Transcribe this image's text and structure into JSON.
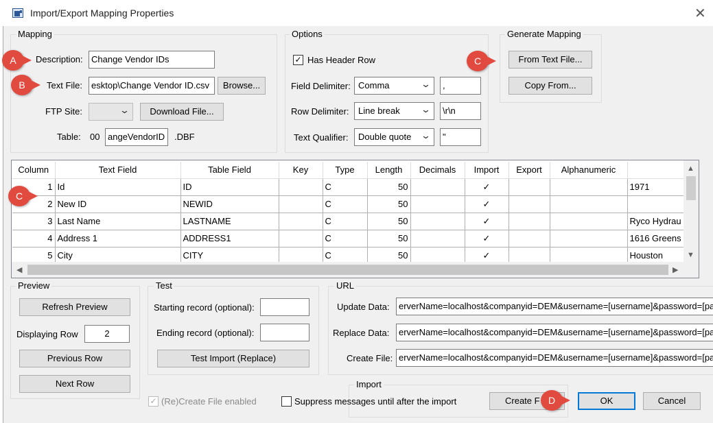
{
  "window": {
    "title": "Import/Export Mapping Properties",
    "close_glyph": "✕"
  },
  "mapping": {
    "group_label": "Mapping",
    "description_label": "Description:",
    "description_value": "Change Vendor IDs",
    "textfile_label": "Text File:",
    "textfile_value": "esktop\\Change Vendor ID.csv",
    "browse_label": "Browse...",
    "ftp_label": "FTP Site:",
    "download_label": "Download File...",
    "table_label": "Table:",
    "table_prefix": "00",
    "table_value": "angeVendorID",
    "table_ext": ".DBF"
  },
  "options": {
    "group_label": "Options",
    "has_header_label": "Has Header Row",
    "has_header_checked": true,
    "field_delim_label": "Field Delimiter:",
    "field_delim_value": "Comma",
    "field_delim_char": ",",
    "row_delim_label": "Row Delimiter:",
    "row_delim_value": "Line break",
    "row_delim_char": "\\r\\n",
    "text_qual_label": "Text Qualifier:",
    "text_qual_value": "Double quote",
    "text_qual_char": "\""
  },
  "generate": {
    "group_label": "Generate Mapping",
    "from_text_label": "From Text File...",
    "copy_from_label": "Copy From..."
  },
  "grid": {
    "columns": [
      "Column",
      "Text Field",
      "Table Field",
      "Key",
      "Type",
      "Length",
      "Decimals",
      "Import",
      "Export",
      "Alphanumeric",
      ""
    ],
    "rows": [
      {
        "col": "1",
        "text_field": "Id",
        "table_field": "ID",
        "key": "",
        "type": "C",
        "length": "50",
        "decimals": "",
        "import": "✓",
        "export": "",
        "alpha": "",
        "extra": "1971"
      },
      {
        "col": "2",
        "text_field": "New ID",
        "table_field": "NEWID",
        "key": "",
        "type": "C",
        "length": "50",
        "decimals": "",
        "import": "✓",
        "export": "",
        "alpha": "",
        "extra": ""
      },
      {
        "col": "3",
        "text_field": "Last Name",
        "table_field": "LASTNAME",
        "key": "",
        "type": "C",
        "length": "50",
        "decimals": "",
        "import": "✓",
        "export": "",
        "alpha": "",
        "extra": "Ryco Hydrau"
      },
      {
        "col": "4",
        "text_field": "Address 1",
        "table_field": "ADDRESS1",
        "key": "",
        "type": "C",
        "length": "50",
        "decimals": "",
        "import": "✓",
        "export": "",
        "alpha": "",
        "extra": "1616 Greens"
      },
      {
        "col": "5",
        "text_field": "City",
        "table_field": "CITY",
        "key": "",
        "type": "C",
        "length": "50",
        "decimals": "",
        "import": "✓",
        "export": "",
        "alpha": "",
        "extra": "Houston"
      }
    ]
  },
  "preview": {
    "group_label": "Preview",
    "refresh_label": "Refresh Preview",
    "displaying_label": "Displaying Row",
    "displaying_value": "2",
    "previous_label": "Previous Row",
    "next_label": "Next Row"
  },
  "test": {
    "group_label": "Test",
    "starting_label": "Starting record (optional):",
    "starting_value": "",
    "ending_label": "Ending record (optional):",
    "ending_value": "",
    "test_import_label": "Test Import (Replace)"
  },
  "url": {
    "group_label": "URL",
    "update_label": "Update Data:",
    "update_value": "erverName=localhost&companyid=DEM&username=[username]&password=[pa",
    "replace_label": "Replace Data:",
    "replace_value": "erverName=localhost&companyid=DEM&username=[username]&password=[pa",
    "create_label": "Create File:",
    "create_value": "erverName=localhost&companyid=DEM&username=[username]&password=[pa"
  },
  "import_group": {
    "group_label": "Import",
    "create_file_label": "Create F"
  },
  "footer": {
    "recreate_label": "(Re)Create File enabled",
    "recreate_checked": true,
    "suppress_label": "Suppress messages until after the import",
    "suppress_checked": false,
    "ok_label": "OK",
    "cancel_label": "Cancel"
  },
  "markers": {
    "a": "A",
    "b": "B",
    "c1": "C",
    "c2": "C",
    "d": "D"
  },
  "colors": {
    "marker": "#e04a3f",
    "dialog_bg": "#f0f0f0"
  }
}
